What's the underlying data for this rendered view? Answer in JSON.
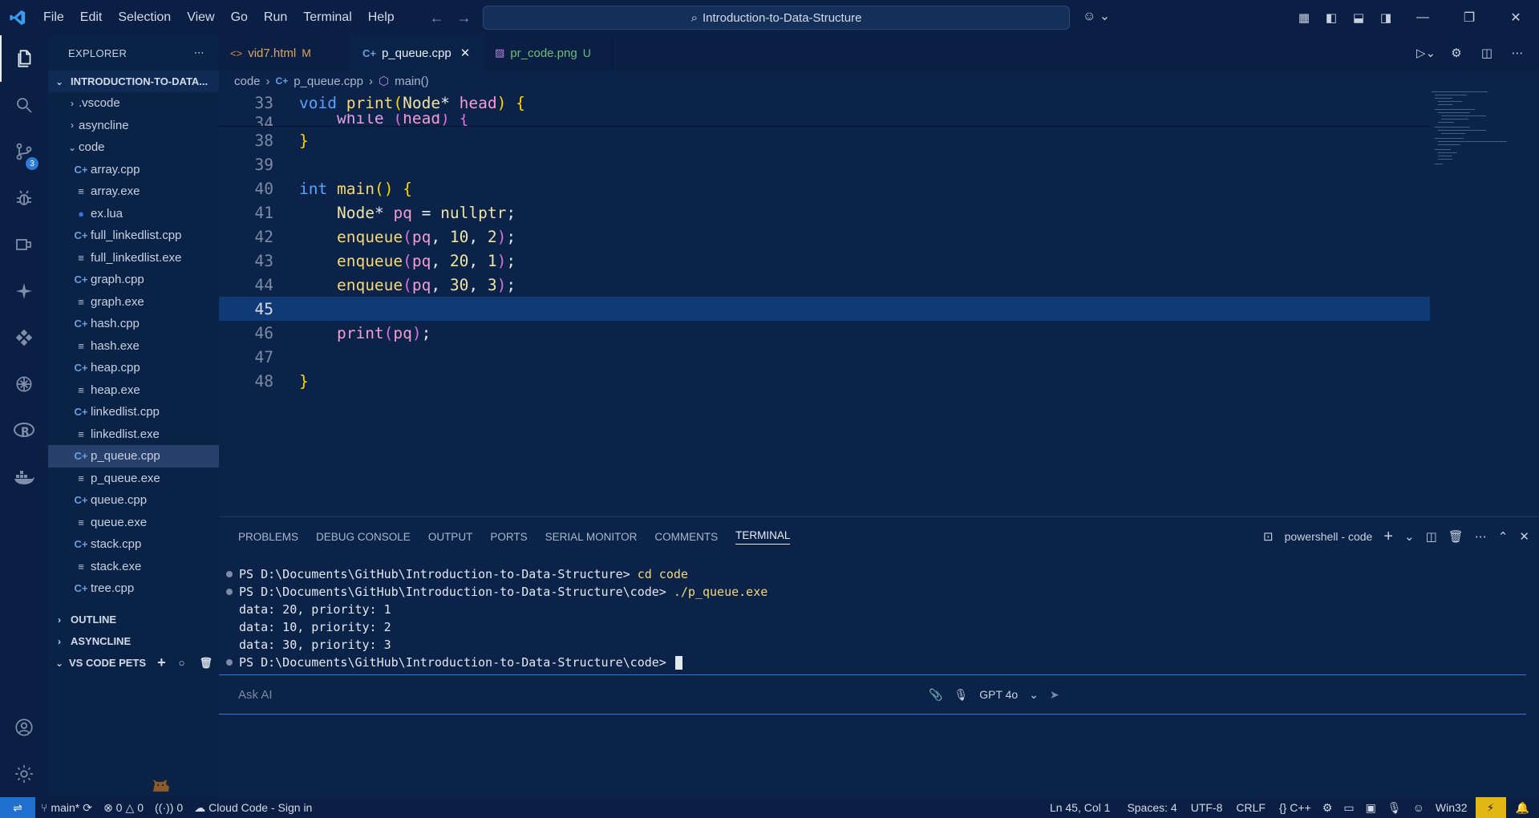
{
  "title_bar": {
    "menu": [
      "File",
      "Edit",
      "Selection",
      "View",
      "Go",
      "Run",
      "Terminal",
      "Help"
    ],
    "search_text": "Introduction-to-Data-Structure"
  },
  "activity_bar": {
    "source_control_badge": "3"
  },
  "explorer": {
    "header": "EXPLORER",
    "root": "INTRODUCTION-TO-DATA...",
    "folders_top": [
      ".vscode",
      "asyncline"
    ],
    "open_folder": "code",
    "files": [
      {
        "name": "array.cpp",
        "icon": "cpp"
      },
      {
        "name": "array.exe",
        "icon": "exe"
      },
      {
        "name": "ex.lua",
        "icon": "lua"
      },
      {
        "name": "full_linkedlist.cpp",
        "icon": "cpp"
      },
      {
        "name": "full_linkedlist.exe",
        "icon": "exe"
      },
      {
        "name": "graph.cpp",
        "icon": "cpp"
      },
      {
        "name": "graph.exe",
        "icon": "exe"
      },
      {
        "name": "hash.cpp",
        "icon": "cpp"
      },
      {
        "name": "hash.exe",
        "icon": "exe"
      },
      {
        "name": "heap.cpp",
        "icon": "cpp"
      },
      {
        "name": "heap.exe",
        "icon": "exe"
      },
      {
        "name": "linkedlist.cpp",
        "icon": "cpp"
      },
      {
        "name": "linkedlist.exe",
        "icon": "exe"
      },
      {
        "name": "p_queue.cpp",
        "icon": "cpp"
      },
      {
        "name": "p_queue.exe",
        "icon": "exe"
      },
      {
        "name": "queue.cpp",
        "icon": "cpp"
      },
      {
        "name": "queue.exe",
        "icon": "exe"
      },
      {
        "name": "stack.cpp",
        "icon": "cpp"
      },
      {
        "name": "stack.exe",
        "icon": "exe"
      },
      {
        "name": "tree.cpp",
        "icon": "cpp"
      }
    ],
    "selected_file": "p_queue.cpp",
    "outline": "OUTLINE",
    "asyncline_section": "ASYNCLINE",
    "pets": "VS CODE PETS"
  },
  "tabs": [
    {
      "label": "vid7.html",
      "status": "M",
      "icon": "html"
    },
    {
      "label": "p_queue.cpp",
      "status": "",
      "icon": "cpp",
      "active": true
    },
    {
      "label": "pr_code.png",
      "status": "U",
      "icon": "image"
    }
  ],
  "breadcrumb": [
    "code",
    "p_queue.cpp",
    "main()"
  ],
  "editor": {
    "line_numbers": [
      "33",
      "34",
      "38",
      "39",
      "40",
      "41",
      "42",
      "43",
      "44",
      "45",
      "46",
      "47",
      "48"
    ],
    "current_line": "45"
  },
  "panel": {
    "tabs": [
      "PROBLEMS",
      "DEBUG CONSOLE",
      "OUTPUT",
      "PORTS",
      "SERIAL MONITOR",
      "COMMENTS",
      "TERMINAL"
    ],
    "active_tab": "TERMINAL",
    "terminal_name": "powershell - code",
    "lines": [
      {
        "prompt": "PS D:\\Documents\\GitHub\\Introduction-to-Data-Structure> ",
        "cmd": "cd code",
        "dot": true
      },
      {
        "prompt": "PS D:\\Documents\\GitHub\\Introduction-to-Data-Structure\\code> ",
        "cmd": "./p_queue.exe",
        "dot": true
      },
      {
        "prompt": "data: 20, priority: 1",
        "cmd": "",
        "dot": false
      },
      {
        "prompt": "data: 10, priority: 2",
        "cmd": "",
        "dot": false
      },
      {
        "prompt": "data: 30, priority: 3",
        "cmd": "",
        "dot": false
      },
      {
        "prompt": "PS D:\\Documents\\GitHub\\Introduction-to-Data-Structure\\code> ",
        "cmd": "",
        "dot": true,
        "cursor": true
      }
    ],
    "ask_ai_placeholder": "Ask AI",
    "model": "GPT 4o"
  },
  "status_bar": {
    "branch": "main*",
    "errors": "0",
    "warnings": "0",
    "ports": "0",
    "cloud_code": "Cloud Code - Sign in",
    "position": "Ln 45, Col 1",
    "spaces": "Spaces: 4",
    "encoding": "UTF-8",
    "eol": "CRLF",
    "language": "C++",
    "platform": "Win32"
  },
  "colors": {
    "background": "#0c2349",
    "accent": "#2f7bd8",
    "current_line": "#0f3a75"
  }
}
